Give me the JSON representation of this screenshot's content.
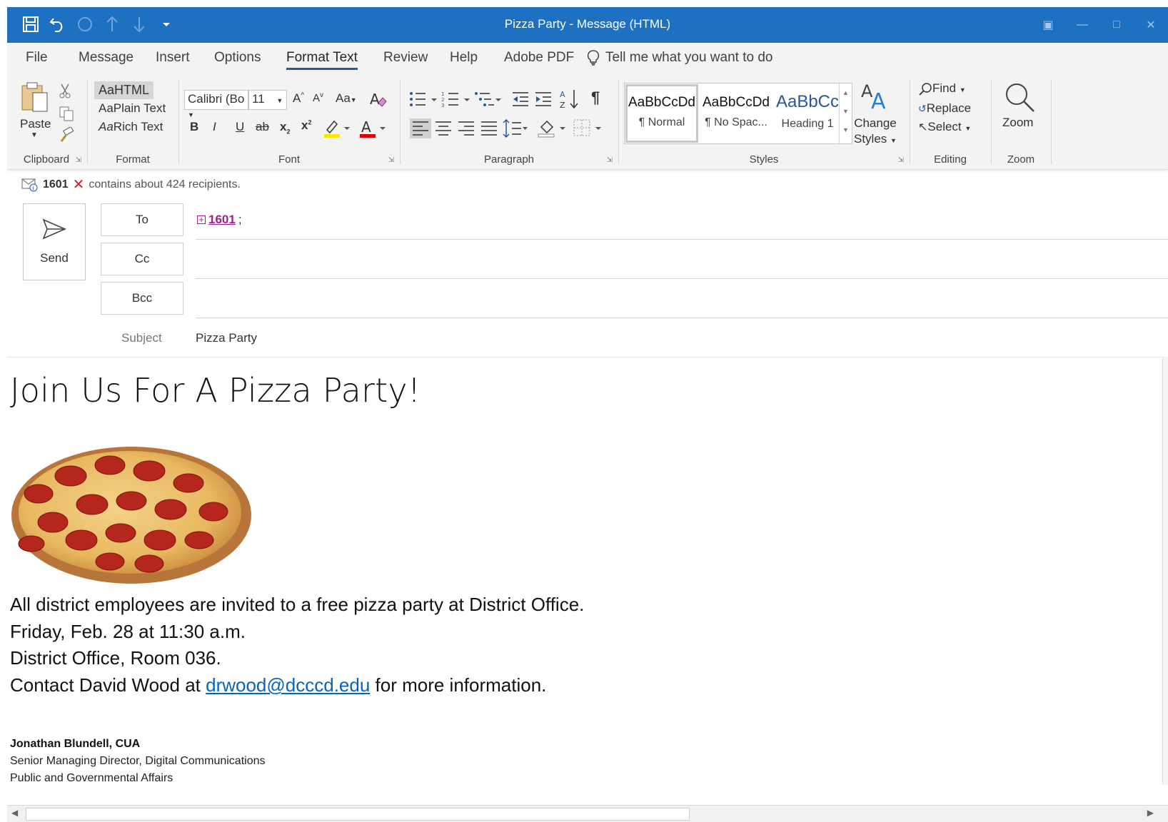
{
  "window": {
    "title": "Pizza Party  -  Message (HTML)"
  },
  "tabs": [
    "File",
    "Message",
    "Insert",
    "Options",
    "Format Text",
    "Review",
    "Help",
    "Adobe PDF"
  ],
  "active_tab": "Format Text",
  "tell_me": "Tell me what you want to do",
  "ribbon": {
    "clipboard": {
      "paste": "Paste",
      "label": "Clipboard"
    },
    "format": {
      "html": "HTML",
      "plain": "Plain Text",
      "rich": "Rich Text",
      "aa": "Aa",
      "label": "Format"
    },
    "font": {
      "family": "Calibri (Bo",
      "size": "11",
      "label": "Font",
      "grow": "A",
      "shrink": "A",
      "case": "Aa",
      "bold": "B",
      "italic": "I",
      "underline": "U",
      "strike": "ab",
      "sub": "x",
      "sup": "x"
    },
    "paragraph": {
      "label": "Paragraph"
    },
    "styles": {
      "label": "Styles",
      "items": [
        {
          "sample": "AaBbCcDd",
          "name": "¶ Normal"
        },
        {
          "sample": "AaBbCcDd",
          "name": "¶ No Spac..."
        },
        {
          "sample": "AaBbCc",
          "name": "Heading 1"
        }
      ],
      "change_styles": "Change",
      "change_styles_2": "Styles"
    },
    "editing": {
      "find": "Find",
      "replace": "Replace",
      "select": "Select",
      "label": "Editing"
    },
    "zoom": {
      "button": "Zoom",
      "label": "Zoom"
    }
  },
  "infobar": {
    "group": "1601",
    "text": "contains about 424 recipients."
  },
  "header": {
    "send": "Send",
    "to_label": "To",
    "cc_label": "Cc",
    "bcc_label": "Bcc",
    "to_value": "1601",
    "to_suffix": ";",
    "subject_label": "Subject",
    "subject_value": "Pizza Party"
  },
  "body": {
    "heading": "Join Us For A Pizza Party!",
    "line1": "All district employees are invited to a free pizza party at District Office.",
    "line2": "Friday, Feb. 28 at 11:30 a.m.",
    "line3": "District Office, Room 036.",
    "line4_pre": "Contact David Wood at ",
    "line4_link": "drwood@dcccd.edu",
    "line4_post": " for more information.",
    "sig_name": "Jonathan Blundell, CUA",
    "sig_title": "Senior Managing Director, Digital Communications",
    "sig_dept": "Public and Governmental Affairs"
  },
  "colors": {
    "titlebar": "#1e70c1",
    "accent": "#2b579a",
    "link": "#0563c1",
    "recipient": "#a0218a"
  },
  "icons": [
    "save-icon",
    "undo-icon",
    "redo-icon",
    "up-arrow-icon",
    "down-arrow-icon",
    "customize-icon",
    "lightbulb-icon",
    "paste-icon",
    "cut-icon",
    "copy-icon",
    "format-painter-icon",
    "send-icon",
    "find-icon",
    "zoom-icon"
  ]
}
